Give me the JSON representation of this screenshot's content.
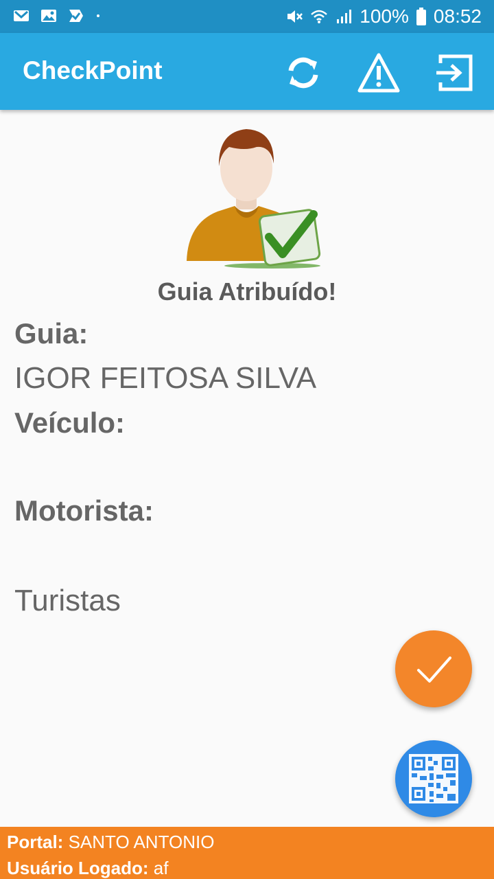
{
  "status_bar": {
    "left_icons": [
      "gmail-icon",
      "image-icon",
      "task-check-icon",
      "dot-icon"
    ],
    "battery": "100%",
    "time": "08:52"
  },
  "app_bar": {
    "title": "CheckPoint",
    "actions": [
      "refresh-icon",
      "warning-icon",
      "exit-icon"
    ]
  },
  "assignment": {
    "status_title": "Guia Atribuído!",
    "guia_label": "Guia:",
    "guia_value": "IGOR FEITOSA SILVA",
    "veiculo_label": "Veículo:",
    "motorista_label": "Motorista:",
    "turistas_value": "Turistas"
  },
  "footer": {
    "portal_label": "Portal:",
    "portal_value": "SANTO ANTONIO",
    "user_label": "Usuário Logado:",
    "user_value": "af"
  },
  "colors": {
    "status_bar": "#1f8fc4",
    "app_bar": "#29a9e1",
    "fab_confirm": "#f3862a",
    "fab_qr": "#2f8ae6",
    "footer": "#f38321"
  }
}
